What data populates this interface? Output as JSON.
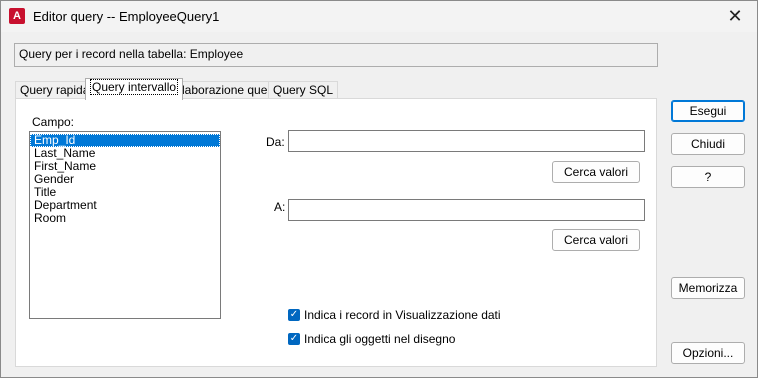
{
  "window": {
    "title": "Editor query -- EmployeeQuery1",
    "close_glyph": "✕",
    "app_icon_letter": "A"
  },
  "info": {
    "text": "Query per i record nella tabella:  Employee"
  },
  "tabs": [
    {
      "label": "Query rapida",
      "active": false
    },
    {
      "label": "Query intervallo",
      "active": true
    },
    {
      "label": "Elaborazione query",
      "active": false
    },
    {
      "label": "Query SQL",
      "active": false
    }
  ],
  "field": {
    "label": "Campo:",
    "items": [
      "Emp_Id",
      "Last_Name",
      "First_Name",
      "Gender",
      "Title",
      "Department",
      "Room"
    ],
    "selected": "Emp_Id"
  },
  "range": {
    "from_label": "Da:",
    "from_value": "",
    "to_label": "A:",
    "to_value": "",
    "lookup_label": "Cerca valori"
  },
  "options": {
    "show_in_datasheet": "Indica i record in Visualizzazione dati",
    "show_in_drawing": "Indica gli oggetti nel disegno",
    "show_in_datasheet_checked": true,
    "show_in_drawing_checked": true
  },
  "buttons": {
    "execute": "Esegui",
    "close": "Chiudi",
    "help": "?",
    "store": "Memorizza",
    "options": "Opzioni..."
  },
  "colors": {
    "accent": "#0078d7",
    "app_icon": "#c8102e"
  }
}
